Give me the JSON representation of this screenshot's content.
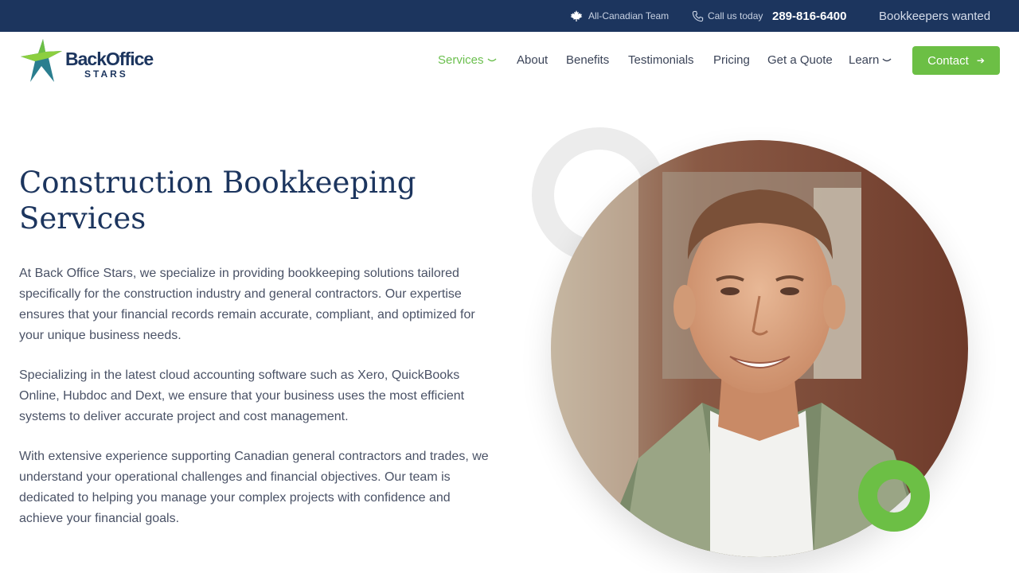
{
  "topbar": {
    "canada_icon": "maple-leaf-icon",
    "canada_label": "All-Canadian Team",
    "phone_icon": "phone-icon",
    "call_label": "Call us today",
    "phone_number": "289-816-6400",
    "hiring_label": "Bookkeepers wanted"
  },
  "logo": {
    "name": "BackOffice",
    "sub": "STARS"
  },
  "nav": {
    "items": [
      {
        "label": "Services",
        "active": true,
        "dropdown": true
      },
      {
        "label": "About"
      },
      {
        "label": "Benefits"
      },
      {
        "label": "Testimonials"
      },
      {
        "label": "Pricing"
      },
      {
        "label": "Get a Quote"
      },
      {
        "label": "Learn",
        "dropdown": true
      }
    ],
    "contact_label": "Contact",
    "contact_icon": "arrow-right-icon"
  },
  "hero": {
    "title": "Construction Bookkeeping Services",
    "paragraphs": [
      "At Back Office Stars, we specialize in providing bookkeeping solutions tailored specifically for the construction industry and general contractors. Our expertise ensures that your financial records remain accurate, compliant, and optimized for your unique business needs.",
      "Specializing in the latest cloud accounting software such as Xero, QuickBooks Online, Hubdoc and Dext, we ensure that your business uses the most efficient systems to deliver accurate project and cost management.",
      "With extensive experience supporting Canadian general contractors and trades, we understand your operational challenges and financial objectives. Our team is dedicated to helping you manage your complex projects with confidence and achieve your financial goals."
    ]
  },
  "colors": {
    "navy": "#1c355e",
    "green": "#6cbf45",
    "teal": "#2a7e8f",
    "text": "#4a5266"
  }
}
